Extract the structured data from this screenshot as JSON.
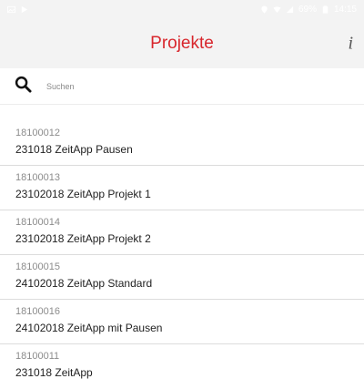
{
  "status_bar": {
    "battery": "69%",
    "time": "14:15"
  },
  "header": {
    "title": "Projekte",
    "info_label": "i",
    "title_color": "#d8262c"
  },
  "search": {
    "placeholder": "Suchen",
    "value": ""
  },
  "projects": [
    {
      "number": "18100012",
      "name": "231018 ZeitApp Pausen"
    },
    {
      "number": "18100013",
      "name": "23102018 ZeitApp Projekt 1"
    },
    {
      "number": "18100014",
      "name": "23102018 ZeitApp Projekt 2"
    },
    {
      "number": "18100015",
      "name": "24102018 ZeitApp Standard"
    },
    {
      "number": "18100016",
      "name": "24102018 ZeitApp mit Pausen"
    },
    {
      "number": "18100011",
      "name": "231018 ZeitApp"
    }
  ]
}
